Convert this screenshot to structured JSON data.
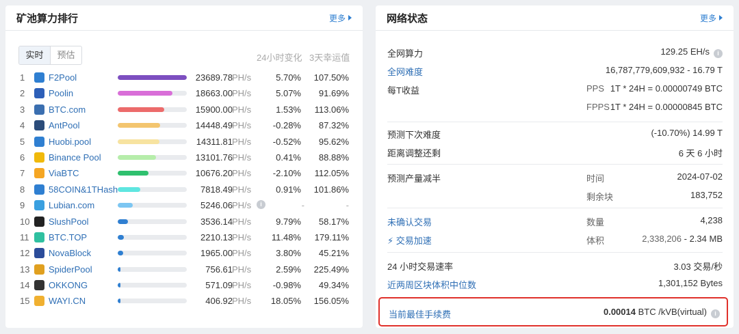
{
  "left": {
    "title": "矿池算力排行",
    "more": "更多",
    "tabs": [
      "实时",
      "预估"
    ],
    "col_change": "24小时变化",
    "col_luck": "3天幸运值",
    "unit": "PH/s",
    "pools": [
      {
        "rank": "1",
        "name": "F2Pool",
        "hashrate": "23689.78",
        "fill": 1.0,
        "color": "#7d4fc0",
        "logo": "#2f7fd1",
        "change": "5.70%",
        "luck": "107.50%"
      },
      {
        "rank": "2",
        "name": "Poolin",
        "hashrate": "18663.00",
        "fill": 0.79,
        "color": "#d96fd8",
        "logo": "#2d5fb8",
        "change": "5.07%",
        "luck": "91.69%"
      },
      {
        "rank": "3",
        "name": "BTC.com",
        "hashrate": "15900.00",
        "fill": 0.67,
        "color": "#ec6b6b",
        "logo": "#3b6fb0",
        "change": "1.53%",
        "luck": "113.06%"
      },
      {
        "rank": "4",
        "name": "AntPool",
        "hashrate": "14448.49",
        "fill": 0.61,
        "color": "#f3c56f",
        "logo": "#2b4c7a",
        "change": "-0.28%",
        "luck": "87.32%"
      },
      {
        "rank": "5",
        "name": "Huobi.pool",
        "hashrate": "14311.81",
        "fill": 0.6,
        "color": "#f7e3a0",
        "logo": "#2f7fd1",
        "change": "-0.52%",
        "luck": "95.62%"
      },
      {
        "rank": "6",
        "name": "Binance Pool",
        "hashrate": "13101.76",
        "fill": 0.55,
        "color": "#b6edaa",
        "logo": "#f0b90b",
        "change": "0.41%",
        "luck": "88.88%"
      },
      {
        "rank": "7",
        "name": "ViaBTC",
        "hashrate": "10676.20",
        "fill": 0.45,
        "color": "#2fc06e",
        "logo": "#f5a623",
        "change": "-2.10%",
        "luck": "112.05%"
      },
      {
        "rank": "8",
        "name": "58COIN&1THash",
        "hashrate": "7818.49",
        "fill": 0.33,
        "color": "#5fe6e0",
        "logo": "#2f7fd1",
        "change": "0.91%",
        "luck": "101.86%"
      },
      {
        "rank": "9",
        "name": "Lubian.com",
        "hashrate": "5246.06",
        "fill": 0.22,
        "color": "#7cc6f2",
        "logo": "#3aa0e0",
        "change": "-",
        "luck": "-"
      },
      {
        "rank": "10",
        "name": "SlushPool",
        "hashrate": "3536.14",
        "fill": 0.15,
        "color": "#2f7fd1",
        "logo": "#222222",
        "change": "9.79%",
        "luck": "58.17%"
      },
      {
        "rank": "11",
        "name": "BTC.TOP",
        "hashrate": "2210.13",
        "fill": 0.09,
        "color": "#2f7fd1",
        "logo": "#2fc0a0",
        "change": "11.48%",
        "luck": "179.11%"
      },
      {
        "rank": "12",
        "name": "NovaBlock",
        "hashrate": "1965.00",
        "fill": 0.08,
        "color": "#2f7fd1",
        "logo": "#2b4c9a",
        "change": "3.80%",
        "luck": "45.21%"
      },
      {
        "rank": "13",
        "name": "SpiderPool",
        "hashrate": "756.61",
        "fill": 0.03,
        "color": "#2f7fd1",
        "logo": "#e0a020",
        "change": "2.59%",
        "luck": "225.49%"
      },
      {
        "rank": "14",
        "name": "OKKONG",
        "hashrate": "571.09",
        "fill": 0.024,
        "color": "#2f7fd1",
        "logo": "#333333",
        "change": "-0.98%",
        "luck": "49.34%"
      },
      {
        "rank": "15",
        "name": "WAYI.CN",
        "hashrate": "406.92",
        "fill": 0.017,
        "color": "#2f7fd1",
        "logo": "#f0b030",
        "change": "18.05%",
        "luck": "156.05%"
      }
    ]
  },
  "right": {
    "title": "网络状态",
    "more": "更多",
    "total_hash_label": "全网算力",
    "total_hash_value": "129.25 EH/s",
    "difficulty_label": "全网难度",
    "difficulty_value": "16,787,779,609,932 - 16.79 T",
    "per_t_label": "每T收益",
    "pps_label": "PPS",
    "pps_value": "1T * 24H = 0.00000749 BTC",
    "fpps_label": "FPPS",
    "fpps_value": "1T * 24H = 0.00000845 BTC",
    "next_diff_label": "预测下次难度",
    "next_diff_value": "(-10.70%) 14.99 T",
    "adjust_label": "距离调整还剩",
    "adjust_value": "6 天 6 小时",
    "halving_label": "预测产量减半",
    "halving_time_label": "时间",
    "halving_time_value": "2024-07-02",
    "halving_blocks_label": "剩余块",
    "halving_blocks_value": "183,752",
    "unconfirmed_label": "未确认交易",
    "count_label": "数量",
    "count_value": "4,238",
    "accelerate_label": "交易加速",
    "size_label": "体积",
    "size_value_a": "2,338,206",
    "size_value_b": " - 2.34 MB",
    "tx_rate_label": "24 小时交易速率",
    "tx_rate_value": "3.03 交易/秒",
    "median_label": "近两周区块体积中位数",
    "median_value": "1,301,152 Bytes",
    "fee_label": "当前最佳手续费",
    "fee_value_bold": "0.00014",
    "fee_value_rest": " BTC /kVB(virtual)"
  }
}
